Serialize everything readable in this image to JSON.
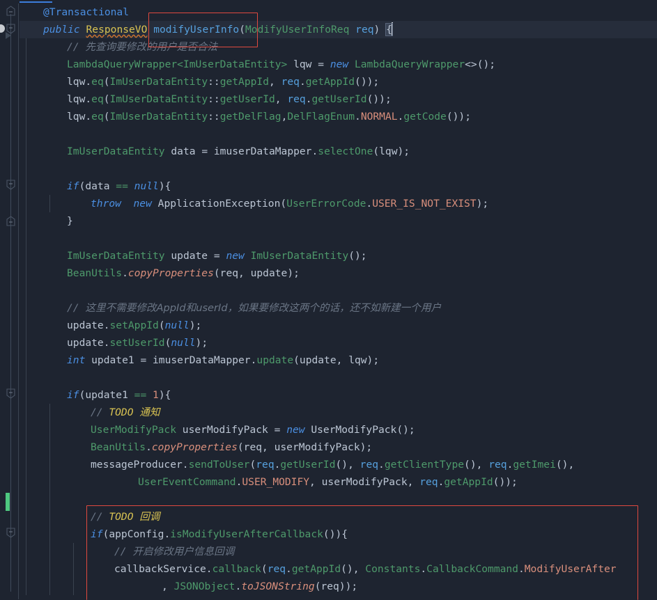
{
  "editor": {
    "theme_background": "#1e2430",
    "caret_line_background": "#262d3b",
    "accent_blue": "#3c7ddb",
    "annotation_red": "#e04a3f",
    "vcs_added_green": "#4ec880",
    "font_size_px": 14.6,
    "line_height_px": 25
  },
  "gutter": {
    "run_icon": "run-gutter-icon",
    "fold_markers": [
      "fold-collapse-up",
      "fold-collapse-down",
      "fold-collapse-down",
      "fold-collapse-up",
      "fold-collapse-down",
      "fold-collapse-down"
    ],
    "vcs_marker": "added-lines-marker"
  },
  "annotations": [
    {
      "name": "signature-highlight",
      "color": "#e04a3f",
      "target": "modifyUserInfo("
    },
    {
      "name": "callback-block-highlight",
      "color": "#e04a3f",
      "target": "TODO callback block"
    }
  ],
  "code": {
    "line_01": {
      "anno": "@Transactional"
    },
    "line_02": {
      "kw_public": "public",
      "type_responsevo": "ResponseVO",
      "meth_name": "modifyUserInfo",
      "paren_open": "(",
      "type_req": "ModifyUserInfoReq",
      "param": "req",
      "paren_close": ")",
      "brace": "{"
    },
    "line_03": {
      "slashes": "// ",
      "comment": "先查询要修改的用户是否合法"
    },
    "line_04": {
      "type": "LambdaQueryWrapper",
      "generic": "<ImUserDataEntity>",
      "var": " lqw ",
      "eq": "= ",
      "kw_new": "new",
      "ctor": " LambdaQueryWrapper",
      "diamond": "<>();"
    },
    "line_05": {
      "head": "lqw.",
      "meth": "eq",
      "p1": "(",
      "type": "ImUserDataEntity",
      "colons": "::",
      "mref": "getAppId",
      "sep": ", ",
      "param": "req",
      "dot": ".",
      "meth2": "getAppId",
      "tail": "());"
    },
    "line_06": {
      "head": "lqw.",
      "meth": "eq",
      "p1": "(",
      "type": "ImUserDataEntity",
      "colons": "::",
      "mref": "getUserId",
      "sep": ", ",
      "param": "req",
      "dot": ".",
      "meth2": "getUserId",
      "tail": "());"
    },
    "line_07": {
      "head": "lqw.",
      "meth": "eq",
      "p1": "(",
      "type": "ImUserDataEntity",
      "colons": "::",
      "mref": "getDelFlag",
      "sep": ",",
      "enum_type": "DelFlagEnum",
      "dot1": ".",
      "enum_const": "NORMAL",
      "dot2": ".",
      "meth2": "getCode",
      "tail": "());"
    },
    "line_09": {
      "type": "ImUserDataEntity",
      "var": " data ",
      "eq": "= ",
      "obj": "imuserDataMapper",
      "dot": ".",
      "meth": "selectOne",
      "tail": "(lqw);"
    },
    "line_11": {
      "kw_if": "if",
      "p1": "(data ",
      "op": "==",
      "sp": " ",
      "kw_null": "null",
      "tail": "){"
    },
    "line_12": {
      "kw_throw": "throw",
      "sp": "  ",
      "kw_new": "new",
      "ctor": " ApplicationException",
      "p1": "(",
      "type": "UserErrorCode",
      "dot": ".",
      "const": "USER_IS_NOT_EXIST",
      "tail": ");"
    },
    "line_13": {
      "brace": "}"
    },
    "line_15": {
      "type": "ImUserDataEntity",
      "var": " update ",
      "eq": "= ",
      "kw_new": "new",
      "ctor": " ImUserDataEntity",
      "tail": "();"
    },
    "line_16": {
      "type": "BeanUtils",
      "dot": ".",
      "meth": "copyProperties",
      "tail": "(req, update);"
    },
    "line_18": {
      "slashes": "// ",
      "comment": "这里不需要修改AppId和userId，如果要修改这两个的话，还不如新建一个用户"
    },
    "line_19": {
      "obj": "update",
      "dot": ".",
      "meth": "setAppId",
      "p1": "(",
      "kw_null": "null",
      "tail": ");"
    },
    "line_20": {
      "obj": "update",
      "dot": ".",
      "meth": "setUserId",
      "p1": "(",
      "kw_null": "null",
      "tail": ");"
    },
    "line_21": {
      "kw_int": "int",
      "var": " update1 ",
      "eq": "= ",
      "obj": "imuserDataMapper",
      "dot": ".",
      "meth": "update",
      "tail": "(update, lqw);"
    },
    "line_23": {
      "kw_if": "if",
      "p1": "(update1 ",
      "op": "==",
      "sp": " ",
      "num": "1",
      "tail": "){"
    },
    "line_24": {
      "slashes": "// ",
      "todo": "TODO ",
      "todo_cn": "通知"
    },
    "line_25": {
      "type": "UserModifyPack",
      "var": " userModifyPack ",
      "eq": "= ",
      "kw_new": "new",
      "ctor": " UserModifyPack",
      "tail": "();"
    },
    "line_26": {
      "type": "BeanUtils",
      "dot": ".",
      "meth": "copyProperties",
      "tail": "(req, userModifyPack);"
    },
    "line_27": {
      "obj": "messageProducer",
      "dot": ".",
      "meth": "sendToUser",
      "p1": "(",
      "param1": "req",
      "d1": ".",
      "m1": "getUserId",
      "s1": "(), ",
      "param2": "req",
      "d2": ".",
      "m2": "getClientType",
      "s2": "(), ",
      "param3": "req",
      "d3": ".",
      "m3": "getImei",
      "tail": "(),"
    },
    "line_28": {
      "type": "UserEventCommand",
      "dot": ".",
      "const": "USER_MODIFY",
      "mid": ", userModifyPack, ",
      "param": "req",
      "d": ".",
      "meth": "getAppId",
      "tail": "());"
    },
    "line_30": {
      "slashes": "// ",
      "todo": "TODO ",
      "todo_cn": "回调"
    },
    "line_31": {
      "kw_if": "if",
      "p1": "(appConfig",
      "dot": ".",
      "meth": "isModifyUserAfterCallback",
      "tail": "()){"
    },
    "line_32": {
      "slashes": "// ",
      "comment": "开启修改用户信息回调"
    },
    "line_33": {
      "obj": "callbackService",
      "dot": ".",
      "meth": "callback",
      "p1": "(",
      "param": "req",
      "d": ".",
      "m": "getAppId",
      "s": "(), ",
      "type1": "Constants",
      "d2": ".",
      "type2": "CallbackCommand",
      "d3": ".",
      "const": "ModifyUserAfter"
    },
    "line_34": {
      "comma": ", ",
      "type": "JSONObject",
      "dot": ".",
      "meth": "toJSONString",
      "tail": "(req));"
    }
  }
}
